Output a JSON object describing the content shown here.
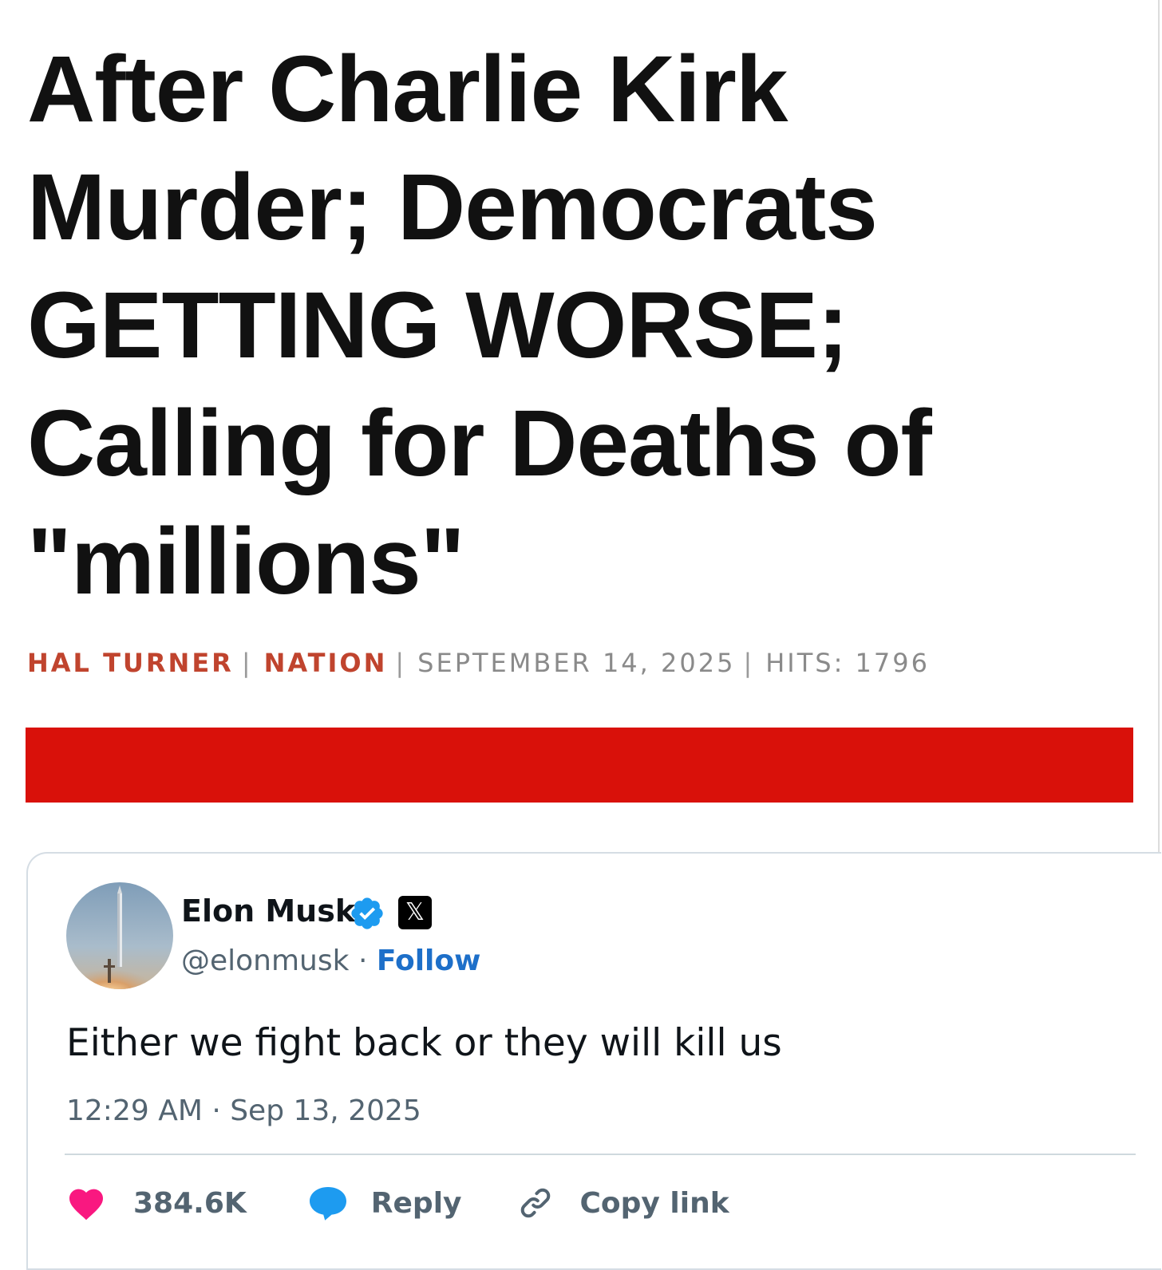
{
  "article": {
    "headline": "After Charlie Kirk Murder; Democrats GETTING WORSE; Calling for Deaths of \"millions\"",
    "byline": {
      "author": "HAL TURNER",
      "category": "NATION",
      "date": "SEPTEMBER 14, 2025",
      "hits": "HITS: 1796",
      "separator": "|"
    },
    "banner_color": "#d9110a"
  },
  "tweet": {
    "name": "Elon Musk",
    "handle": "@elonmusk",
    "dot": "·",
    "follow_label": "Follow",
    "x_logo": "𝕏",
    "text": "Either we fight back or they will kill us",
    "timestamp": "12:29 AM · Sep 13, 2025",
    "likes": "384.6K",
    "reply_label": "Reply",
    "copy_link_label": "Copy link",
    "icons": [
      "verified-badge-icon",
      "x-logo-icon",
      "heart-icon",
      "reply-bubble-icon",
      "link-icon"
    ]
  },
  "colors": {
    "accent_byline": "#c0442e",
    "follow_blue": "#1d6fc9",
    "heart_pink": "#f91880",
    "reply_blue": "#1d9bf0",
    "verified_blue": "#1d9bf0"
  }
}
